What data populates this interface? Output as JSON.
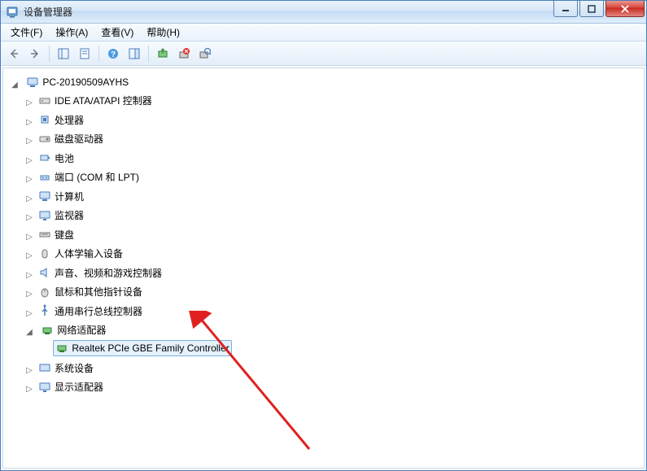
{
  "window": {
    "title": "设备管理器"
  },
  "menu": {
    "file": "文件(F)",
    "action": "操作(A)",
    "view": "查看(V)",
    "help": "帮助(H)"
  },
  "tree": {
    "root": "PC-20190509AYHS",
    "ide": "IDE ATA/ATAPI 控制器",
    "cpu": "处理器",
    "disk": "磁盘驱动器",
    "battery": "电池",
    "port": "端口 (COM 和 LPT)",
    "computer": "计算机",
    "monitor": "监视器",
    "keyboard": "键盘",
    "hid": "人体学输入设备",
    "audio": "声音、视频和游戏控制器",
    "mouse": "鼠标和其他指针设备",
    "usb": "通用串行总线控制器",
    "network": "网络适配器",
    "network_child": "Realtek PCIe GBE Family Controller",
    "system": "系统设备",
    "display": "显示适配器"
  }
}
